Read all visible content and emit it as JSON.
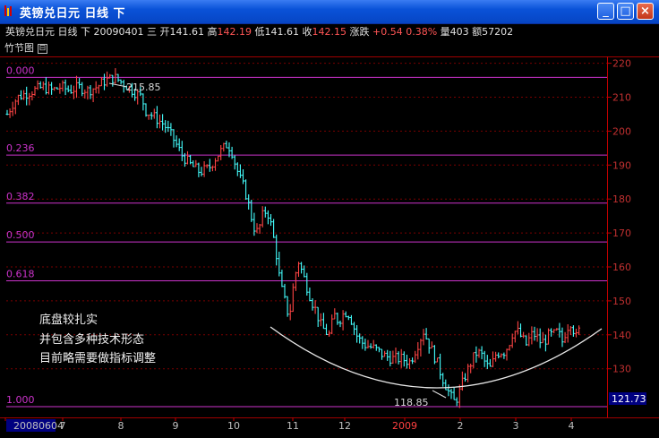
{
  "window": {
    "title": "英镑兑日元  日线  下",
    "btn_min": "_",
    "btn_max": "□",
    "btn_close": "×"
  },
  "info": {
    "symbol": "英镑兑日元",
    "period": "日线",
    "mode": "下",
    "date": "20090401",
    "weekday": "三",
    "open_label": "开",
    "open": "141.61",
    "high_label": "高",
    "high": "142.19",
    "low_label": "低",
    "low": "141.61",
    "close_label": "收",
    "close": "142.15",
    "change_label": "涨跌",
    "change": "+0.54",
    "change_pct": "0.38%",
    "volume_label": "量",
    "volume": "403",
    "amount_label": "额",
    "amount": "57202"
  },
  "subbar": {
    "label": "竹节图",
    "toggle": "⊟"
  },
  "chart_data": {
    "type": "bar",
    "title": "",
    "ylim": [
      115,
      222
    ],
    "y_ticks": [
      "220",
      "210",
      "200",
      "190",
      "180",
      "170",
      "160",
      "150",
      "140",
      "130"
    ],
    "current_price_label": "121.73",
    "x_ticks": [
      "20080604",
      "7",
      "8",
      "9",
      "10",
      "11",
      "12",
      "2009",
      "2",
      "3",
      "4"
    ],
    "fib_levels": [
      {
        "label": "0.000"
      },
      {
        "label": "0.236"
      },
      {
        "label": "0.382"
      },
      {
        "label": "0.500"
      },
      {
        "label": "0.618"
      },
      {
        "label": "1.000"
      }
    ],
    "high_annotation": "215.85",
    "low_annotation": "118.85",
    "annotation_lines": [
      "底盘较扎实",
      "并包含多种技术形态",
      "目前略需要做指标调整"
    ],
    "price_path": [
      [
        0,
        205
      ],
      [
        6,
        208
      ],
      [
        12,
        210
      ],
      [
        20,
        211
      ],
      [
        30,
        212
      ],
      [
        40,
        213
      ],
      [
        50,
        212
      ],
      [
        60,
        213
      ],
      [
        70,
        212
      ],
      [
        80,
        213
      ],
      [
        90,
        212
      ],
      [
        100,
        213
      ],
      [
        110,
        215
      ],
      [
        120,
        215.8
      ],
      [
        130,
        214
      ],
      [
        140,
        212
      ],
      [
        150,
        210
      ],
      [
        155,
        206
      ],
      [
        165,
        204
      ],
      [
        175,
        202
      ],
      [
        185,
        198
      ],
      [
        195,
        193
      ],
      [
        205,
        190
      ],
      [
        215,
        188
      ],
      [
        225,
        189
      ],
      [
        235,
        193
      ],
      [
        245,
        196
      ],
      [
        250,
        195
      ],
      [
        255,
        190
      ],
      [
        260,
        186
      ],
      [
        265,
        183
      ],
      [
        270,
        178
      ],
      [
        275,
        172
      ],
      [
        280,
        170
      ],
      [
        285,
        175
      ],
      [
        290,
        177
      ],
      [
        295,
        172
      ],
      [
        300,
        165
      ],
      [
        305,
        155
      ],
      [
        310,
        150
      ],
      [
        315,
        145
      ],
      [
        320,
        155
      ],
      [
        325,
        162
      ],
      [
        330,
        158
      ],
      [
        335,
        154
      ],
      [
        340,
        150
      ],
      [
        345,
        147
      ],
      [
        350,
        143
      ],
      [
        355,
        141
      ],
      [
        360,
        140
      ],
      [
        365,
        146
      ],
      [
        370,
        144
      ],
      [
        375,
        146
      ],
      [
        380,
        147
      ],
      [
        385,
        144
      ],
      [
        390,
        140
      ],
      [
        395,
        138
      ],
      [
        400,
        137
      ],
      [
        410,
        136
      ],
      [
        420,
        134
      ],
      [
        430,
        133
      ],
      [
        440,
        133
      ],
      [
        450,
        132
      ],
      [
        460,
        138
      ],
      [
        465,
        141
      ],
      [
        470,
        138
      ],
      [
        475,
        135
      ],
      [
        480,
        132
      ],
      [
        485,
        128
      ],
      [
        490,
        125
      ],
      [
        495,
        122
      ],
      [
        500,
        120
      ],
      [
        505,
        123
      ],
      [
        510,
        127
      ],
      [
        515,
        130
      ],
      [
        520,
        133
      ],
      [
        525,
        135
      ],
      [
        530,
        134
      ],
      [
        535,
        131
      ],
      [
        540,
        130
      ],
      [
        545,
        134
      ],
      [
        550,
        135
      ],
      [
        555,
        135
      ],
      [
        560,
        137
      ],
      [
        565,
        141
      ],
      [
        570,
        141
      ],
      [
        575,
        139
      ],
      [
        580,
        137
      ],
      [
        585,
        140
      ],
      [
        590,
        140
      ],
      [
        595,
        138
      ],
      [
        600,
        138
      ],
      [
        605,
        140
      ],
      [
        610,
        140
      ],
      [
        615,
        141
      ],
      [
        620,
        138
      ],
      [
        625,
        142
      ],
      [
        630,
        144
      ],
      [
        635,
        139
      ],
      [
        640,
        142
      ]
    ],
    "grid": true
  }
}
